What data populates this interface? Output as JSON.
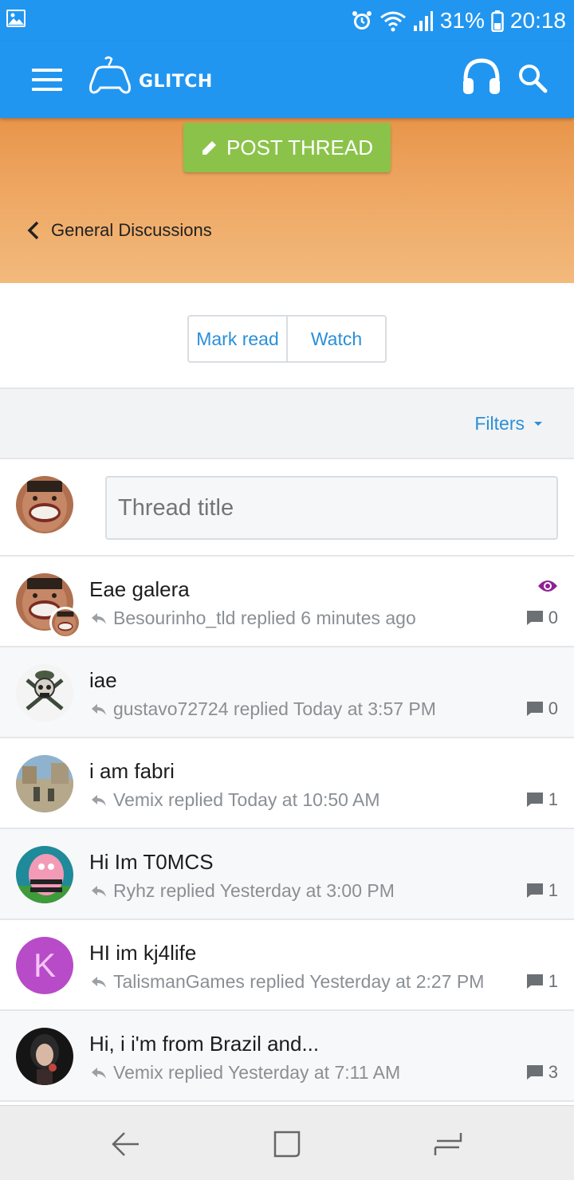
{
  "status_bar": {
    "battery": "31%",
    "time": "20:18",
    "icons": [
      "gallery-icon",
      "alarm-icon",
      "wifi-icon",
      "signal-icon",
      "battery-icon"
    ]
  },
  "app_bar": {
    "logo_text": "GLITCH",
    "icons": [
      "menu-icon",
      "gamepad-logo-icon",
      "headphones-icon",
      "search-icon"
    ],
    "color": "#2196f0"
  },
  "banner": {
    "post_button_label": "POST THREAD",
    "breadcrumb": "General Discussions",
    "post_button_color": "#8bc34a"
  },
  "actions": {
    "mark_read": "Mark read",
    "watch": "Watch"
  },
  "filters": {
    "label": "Filters"
  },
  "quick_thread": {
    "placeholder": "Thread title"
  },
  "threads": [
    {
      "title": "Eae galera",
      "meta": "Besourinho_tld replied 6 minutes ago",
      "replies": "0",
      "avatar": "face-photo",
      "watched": true
    },
    {
      "title": "iae",
      "meta": "gustavo72724 replied Today at 3:57 PM",
      "replies": "0",
      "avatar": "skull-soldier"
    },
    {
      "title": "i am fabri",
      "meta": "Vemix replied Today at 10:50 AM",
      "replies": "1",
      "avatar": "game-scene"
    },
    {
      "title": "Hi Im T0MCS",
      "meta": "Ryhz replied Yesterday at 3:00 PM",
      "replies": "1",
      "avatar": "cartoon-star"
    },
    {
      "title": "HI im kj4life",
      "meta": "TalismanGames replied Yesterday at 2:27 PM",
      "replies": "1",
      "avatar": "K"
    },
    {
      "title": "Hi, i i'm from Brazil and...",
      "meta": "Vemix replied Yesterday at 7:11 AM",
      "replies": "3",
      "avatar": "dark-portrait"
    }
  ],
  "nav_bar": {
    "icons": [
      "back-icon",
      "home-icon",
      "recent-apps-icon"
    ]
  }
}
